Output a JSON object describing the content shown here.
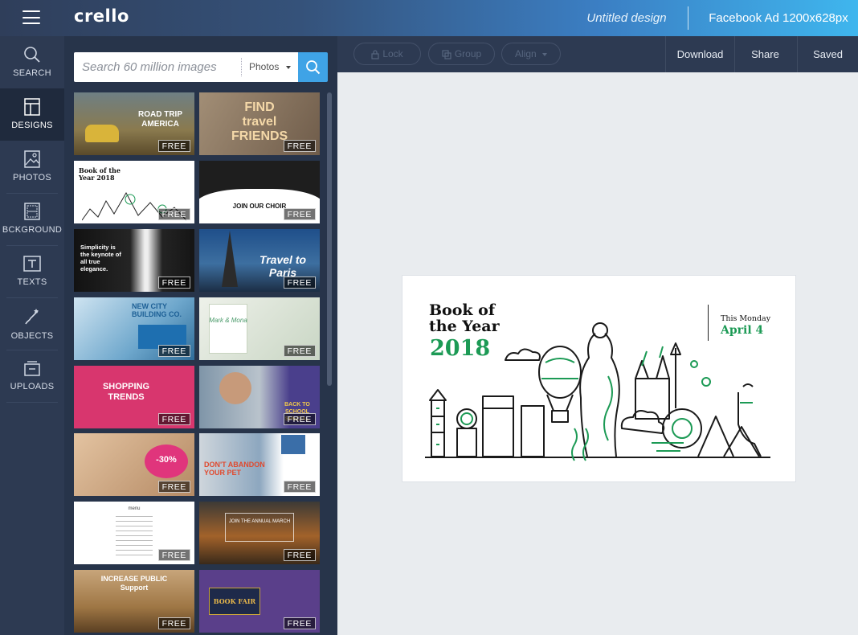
{
  "app": {
    "logo": "crello",
    "doc_title": "Untitled design",
    "doc_size": "Facebook Ad 1200x628px"
  },
  "sidebar": {
    "items": [
      {
        "label": "SEARCH",
        "icon": "search-icon"
      },
      {
        "label": "DESIGNS",
        "icon": "layout-icon",
        "active": true
      },
      {
        "label": "PHOTOS",
        "icon": "image-icon"
      },
      {
        "label": "BCKGROUND",
        "icon": "background-pattern-icon"
      },
      {
        "label": "TEXTS",
        "icon": "text-box-icon"
      },
      {
        "label": "OBJECTS",
        "icon": "brush-star-icon"
      },
      {
        "label": "UPLOADS",
        "icon": "upload-box-icon"
      }
    ]
  },
  "search": {
    "placeholder": "Search 60 million images",
    "filter": "Photos"
  },
  "templates": {
    "badge": "FREE",
    "items": [
      {
        "title": "ROAD TRIP AMERICA",
        "bg": "#7a6a45",
        "badge": "FREE"
      },
      {
        "title": "FIND travel FRIENDS",
        "bg": "#8c7a68",
        "badge": "FREE"
      },
      {
        "title": "Book of the Year 2018",
        "bg": "#ffffff",
        "badge": "FREE"
      },
      {
        "title": "JOIN OUR CHOIR",
        "bg": "#1e1e1e",
        "badge": "FREE"
      },
      {
        "title": "Simplicity is the keynote of all true elegance.",
        "bg": "#151515",
        "badge": "FREE"
      },
      {
        "title": "Travel to Paris",
        "bg": "#2c5a8a",
        "badge": "FREE"
      },
      {
        "title": "NEW CITY BUILDING CO.",
        "bg": "#9fc7e0",
        "badge": "FREE"
      },
      {
        "title": "Mark & Mona",
        "bg": "#dfe6dc",
        "badge": "FREE"
      },
      {
        "title": "SHOPPING TRENDS",
        "bg": "#d8366e",
        "badge": "FREE"
      },
      {
        "title": "BACK TO SCHOOL SPECIAL",
        "bg": "#4a5f88",
        "badge": "FREE"
      },
      {
        "title": "-30%",
        "bg": "#caa07c",
        "badge": "FREE"
      },
      {
        "title": "DON'T ABANDON YOUR PET",
        "bg": "#3a6ea8",
        "badge": "FREE"
      },
      {
        "title": "menu",
        "bg": "#ffffff",
        "badge": "FREE"
      },
      {
        "title": "JOIN THE ANNUAL MARCH",
        "bg": "#8a5a32",
        "badge": "FREE"
      },
      {
        "title": "INCREASE PUBLIC Support",
        "bg": "#b28a56",
        "badge": "FREE"
      },
      {
        "title": "BOOK FAIR",
        "bg": "#5a3f8a",
        "badge": "FREE"
      }
    ]
  },
  "toolbar": {
    "lock": "Lock",
    "group": "Group",
    "align": "Align",
    "download": "Download",
    "share": "Share",
    "status": "Saved"
  },
  "card": {
    "title": "Book of\nthe Year",
    "year": "2018",
    "when": "This Monday",
    "date": "April 4",
    "accent": "#1c9a55"
  }
}
